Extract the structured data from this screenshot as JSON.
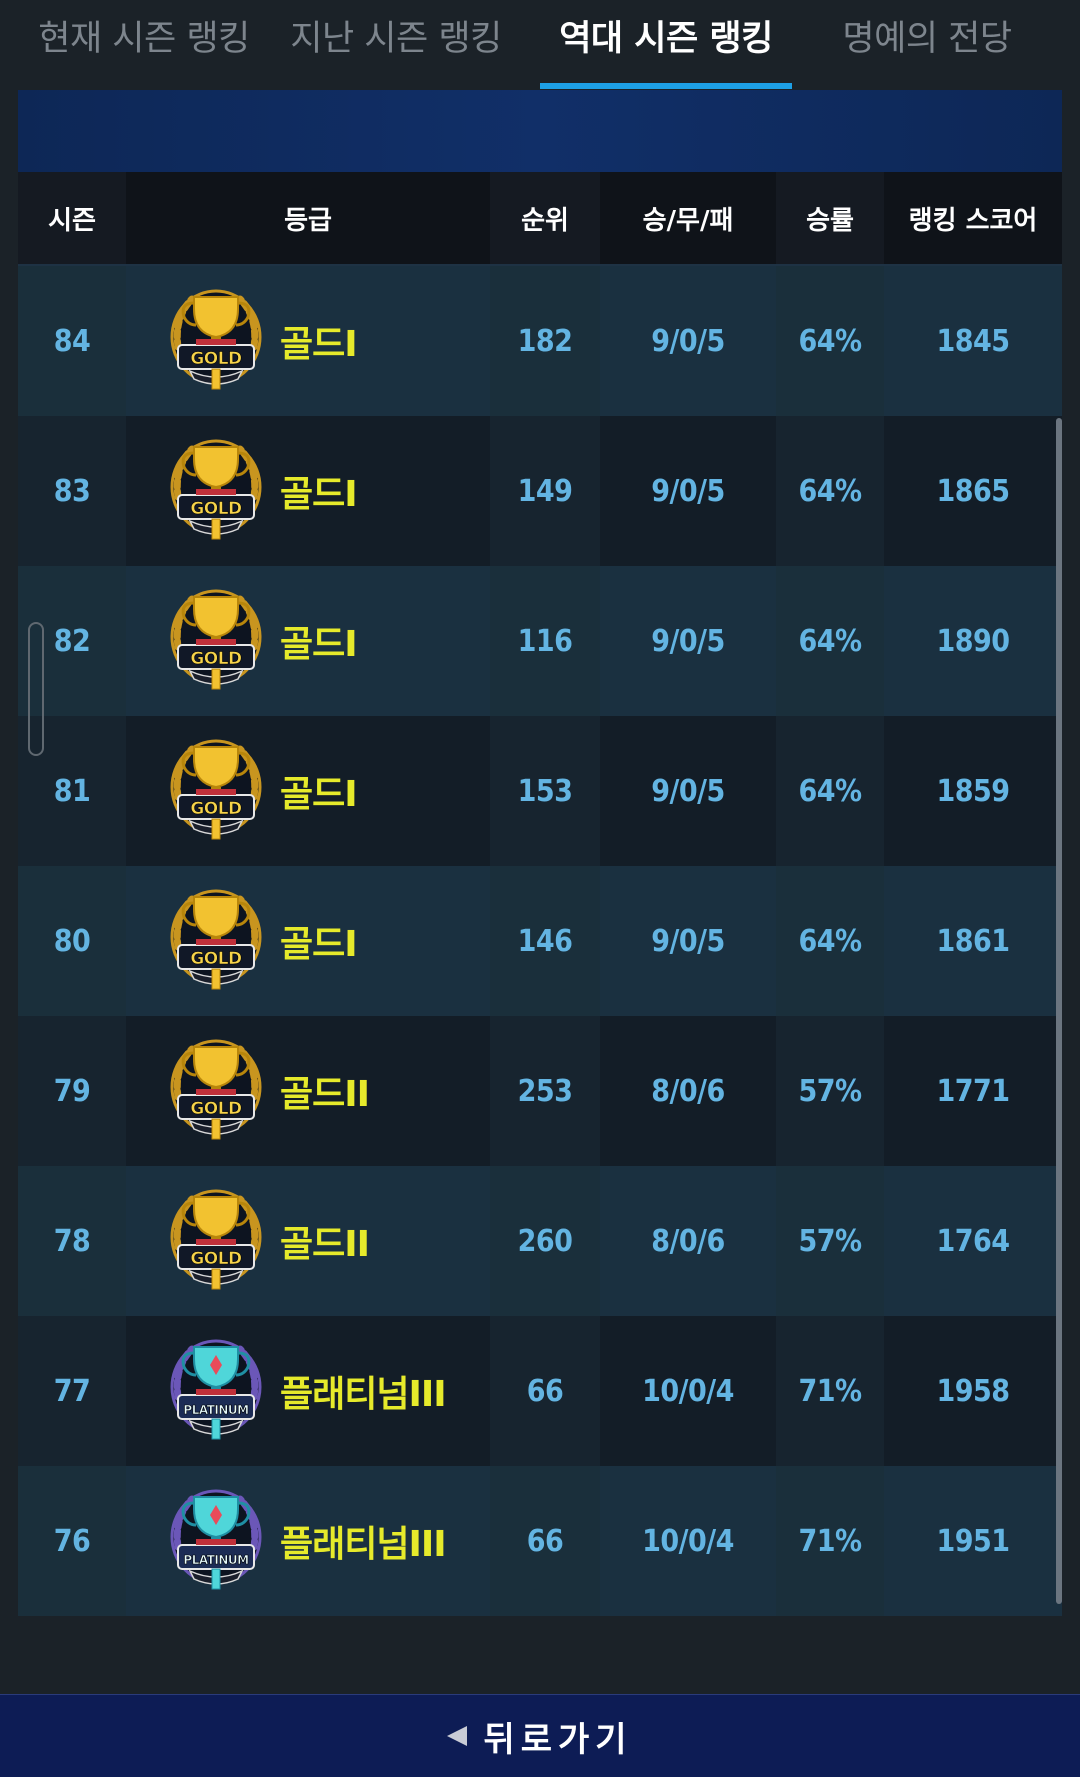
{
  "tabs": [
    {
      "label": "현재 시즌 랭킹",
      "active": false
    },
    {
      "label": "지난 시즌 랭킹",
      "active": false
    },
    {
      "label": "역대 시즌 랭킹",
      "active": true
    },
    {
      "label": "명예의 전당",
      "active": false
    }
  ],
  "table": {
    "headers": [
      "시즌",
      "등급",
      "순위",
      "승/무/패",
      "승률",
      "랭킹 스코어"
    ],
    "rows": [
      {
        "season": "84",
        "tier": "gold",
        "badge_text": "GOLD",
        "grade": "골드I",
        "rank": "182",
        "record": "9/0/5",
        "winrate": "64%",
        "score": "1845"
      },
      {
        "season": "83",
        "tier": "gold",
        "badge_text": "GOLD",
        "grade": "골드I",
        "rank": "149",
        "record": "9/0/5",
        "winrate": "64%",
        "score": "1865"
      },
      {
        "season": "82",
        "tier": "gold",
        "badge_text": "GOLD",
        "grade": "골드I",
        "rank": "116",
        "record": "9/0/5",
        "winrate": "64%",
        "score": "1890"
      },
      {
        "season": "81",
        "tier": "gold",
        "badge_text": "GOLD",
        "grade": "골드I",
        "rank": "153",
        "record": "9/0/5",
        "winrate": "64%",
        "score": "1859"
      },
      {
        "season": "80",
        "tier": "gold",
        "badge_text": "GOLD",
        "grade": "골드I",
        "rank": "146",
        "record": "9/0/5",
        "winrate": "64%",
        "score": "1861"
      },
      {
        "season": "79",
        "tier": "gold",
        "badge_text": "GOLD",
        "grade": "골드II",
        "rank": "253",
        "record": "8/0/6",
        "winrate": "57%",
        "score": "1771"
      },
      {
        "season": "78",
        "tier": "gold",
        "badge_text": "GOLD",
        "grade": "골드II",
        "rank": "260",
        "record": "8/0/6",
        "winrate": "57%",
        "score": "1764"
      },
      {
        "season": "77",
        "tier": "platinum",
        "badge_text": "PLATINUM",
        "grade": "플래티넘III",
        "rank": "66",
        "record": "10/0/4",
        "winrate": "71%",
        "score": "1958"
      },
      {
        "season": "76",
        "tier": "platinum",
        "badge_text": "PLATINUM",
        "grade": "플래티넘III",
        "rank": "66",
        "record": "10/0/4",
        "winrate": "71%",
        "score": "1951"
      }
    ]
  },
  "back": {
    "label": "뒤로가기",
    "icon": "back-arrow-icon"
  },
  "colors": {
    "background": "#1b2228",
    "active_tab": "#ffffff",
    "inactive_tab": "#7d858d",
    "tab_underline": "#1da0e6",
    "value_text": "#63b4e2",
    "grade_text": "#e6ea2b",
    "backbar": "#0d1c55"
  }
}
